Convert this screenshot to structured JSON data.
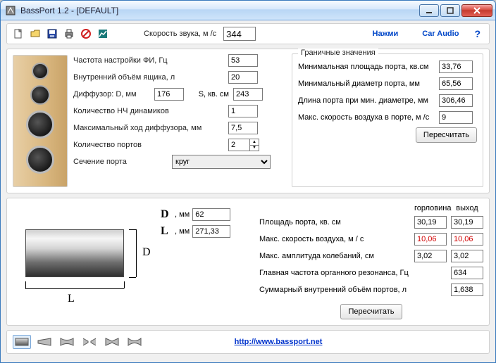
{
  "window": {
    "title": "BassPort 1.2 - [DEFAULT]"
  },
  "toolbar": {
    "soundspeed_label": "Скорость звука, м /с",
    "soundspeed_value": "344",
    "btn_press": "Нажми",
    "btn_caraudio": "Car Audio"
  },
  "params": {
    "tuning_freq_label": "Частота настройки ФИ, Гц",
    "tuning_freq": "53",
    "int_volume_label": "Внутренний объём ящика, л",
    "int_volume": "20",
    "diff_label": "Диффузор: D, мм",
    "diff_d": "176",
    "diff_s_label": "S, кв. см",
    "diff_s": "243",
    "woofers_label": "Количество НЧ динамиков",
    "woofers": "1",
    "xmax_label": "Максимальный ход диффузора, мм",
    "xmax": "7,5",
    "ports_label": "Количество портов",
    "ports": "2",
    "section_label": "Сечение порта",
    "section_value": "круг"
  },
  "limits": {
    "legend": "Граничные значения",
    "min_area_label": "Минимальная площадь порта, кв.см",
    "min_area": "33,76",
    "min_diam_label": "Минимальный диаметр порта, мм",
    "min_diam": "65,56",
    "len_mindiam_label": "Длина порта при мин. диаметре, мм",
    "len_mindiam": "306,46",
    "max_airspeed_label": "Макс. скорость воздуха в порте, м /с",
    "max_airspeed": "9",
    "recalc": "Пересчитать"
  },
  "geom": {
    "D_sym": "D",
    "L_sym": "L",
    "unit": ", мм",
    "D": "62",
    "L": "271,33"
  },
  "results": {
    "col_throat": "горловина",
    "col_exit": "выход",
    "area_label": "Площадь порта, кв. см",
    "area_throat": "30,19",
    "area_exit": "30,19",
    "airspeed_label": "Макс. скорость воздуха, м / с",
    "airspeed_throat": "10,06",
    "airspeed_exit": "10,06",
    "amp_label": "Макс. амплитуда колебаний, см",
    "amp_throat": "3,02",
    "amp_exit": "3,02",
    "organ_label": "Главная частота органного резонанса, Гц",
    "organ": "634",
    "sumvol_label": "Суммарный внутренний объём портов, л",
    "sumvol": "1,638",
    "recalc": "Пересчитать"
  },
  "footer": {
    "url": "http://www.bassport.net"
  }
}
